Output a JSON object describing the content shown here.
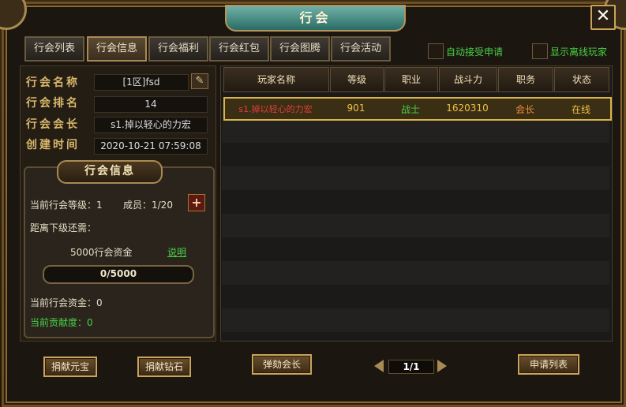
{
  "window": {
    "title": "行会",
    "close_glyph": "✕"
  },
  "tabs": [
    {
      "label": "行会列表",
      "active": false
    },
    {
      "label": "行会信息",
      "active": true
    },
    {
      "label": "行会福利",
      "active": false
    },
    {
      "label": "行会红包",
      "active": false
    },
    {
      "label": "行会图腾",
      "active": false
    },
    {
      "label": "行会活动",
      "active": false
    }
  ],
  "options": {
    "auto_accept_label": "自动接受申请",
    "show_offline_label": "显示离线玩家"
  },
  "guild_info": {
    "name_label": "行会名称",
    "name_value": "[1区]fsd",
    "rank_label": "行会排名",
    "rank_value": "14",
    "leader_label": "行会会长",
    "leader_value": "s1.掉以轻心的力宏",
    "created_label": "创建时间",
    "created_value": "2020-10-21 07:59:08"
  },
  "section": {
    "title": "行会信息",
    "level_text": "当前行会等级：1",
    "members_text": "成员：1/20",
    "next_level_text": "距离下级还需：",
    "funds_needed": "5000行会资金",
    "explain_link": "说明",
    "progress_text": "0/5000",
    "progress_fraction": 0,
    "current_funds": "当前行会资金：0",
    "contribution": "当前贡献度：0"
  },
  "table": {
    "headers": [
      "玩家名称",
      "等级",
      "职业",
      "战斗力",
      "职务",
      "状态"
    ],
    "rows": [
      {
        "name": "s1.掉以轻心的力宏",
        "level": "901",
        "class": "战士",
        "power": "1620310",
        "role": "会长",
        "status": "在线"
      }
    ]
  },
  "buttons": {
    "donate_yuanbao": "捐献元宝",
    "donate_diamond": "捐献钻石",
    "impeach": "弹劾会长",
    "applications": "申请列表"
  },
  "pager": {
    "text": "1/1"
  },
  "colors": {
    "accent_gold": "#c9a45a",
    "green_text": "#47d146",
    "leader_red": "#e0403a",
    "orange": "#f08a3a"
  },
  "icons": {
    "edit": "✎",
    "plus": "+"
  }
}
